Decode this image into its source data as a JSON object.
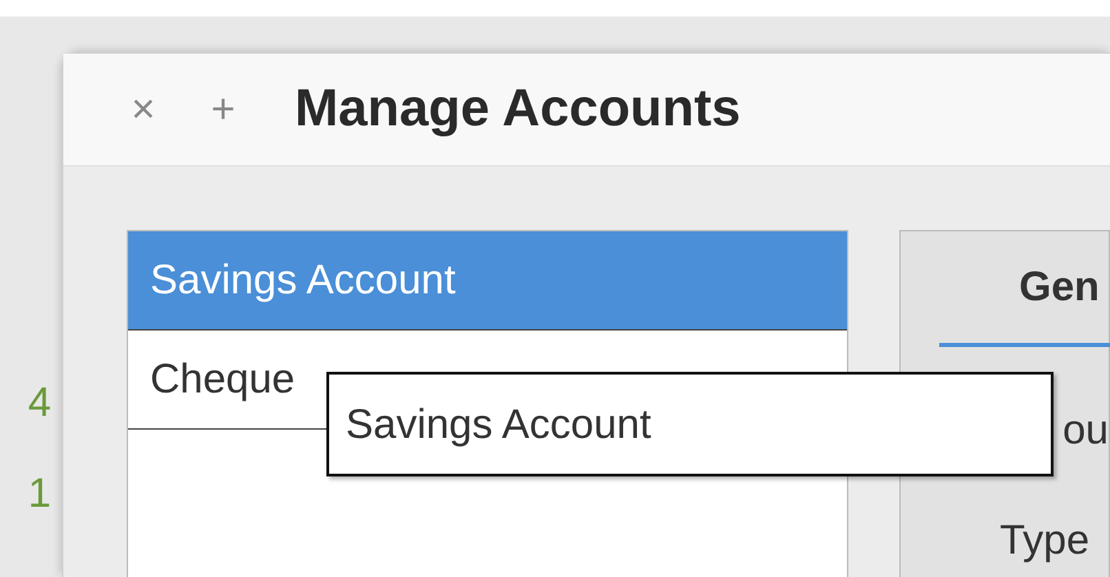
{
  "window": {
    "title": "Manage Accounts",
    "buttons": [
      "×",
      "+"
    ]
  },
  "accounts": [
    {
      "name": "Savings Account",
      "selected": true
    },
    {
      "name": "Cheque",
      "selected": false
    }
  ],
  "tooltip": {
    "text": "Savings Account"
  },
  "tabs": [
    {
      "label": "Gen",
      "selected": true
    }
  ],
  "panel": {
    "labels": [
      "ou",
      "Type"
    ]
  },
  "background": {
    "texts": [
      "4",
      "1"
    ]
  }
}
